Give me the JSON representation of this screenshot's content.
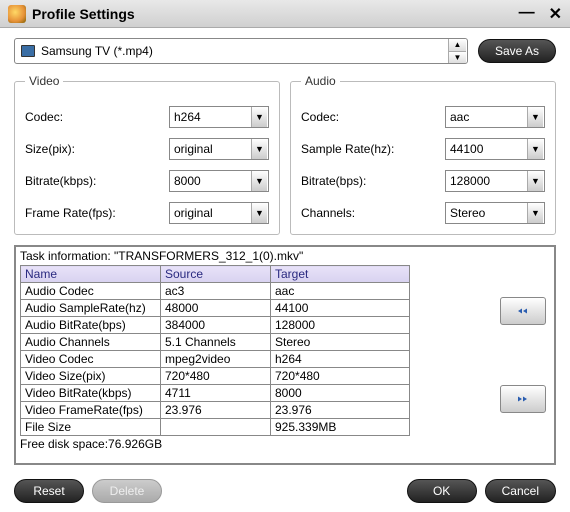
{
  "window": {
    "title": "Profile Settings"
  },
  "profile": {
    "name": "Samsung TV (*.mp4)",
    "save_as": "Save As"
  },
  "video": {
    "legend": "Video",
    "codec_label": "Codec:",
    "codec": "h264",
    "size_label": "Size(pix):",
    "size": "original",
    "bitrate_label": "Bitrate(kbps):",
    "bitrate": "8000",
    "fps_label": "Frame Rate(fps):",
    "fps": "original"
  },
  "audio": {
    "legend": "Audio",
    "codec_label": "Codec:",
    "codec": "aac",
    "sr_label": "Sample Rate(hz):",
    "sr": "44100",
    "bitrate_label": "Bitrate(bps):",
    "bitrate": "128000",
    "ch_label": "Channels:",
    "ch": "Stereo"
  },
  "task": {
    "header": "Task information: \"TRANSFORMERS_312_1(0).mkv\"",
    "cols": {
      "name": "Name",
      "source": "Source",
      "target": "Target"
    },
    "rows": [
      {
        "n": "Audio Codec",
        "s": "ac3",
        "t": "aac"
      },
      {
        "n": "Audio SampleRate(hz)",
        "s": "48000",
        "t": "44100"
      },
      {
        "n": "Audio BitRate(bps)",
        "s": "384000",
        "t": "128000"
      },
      {
        "n": "Audio Channels",
        "s": "5.1 Channels",
        "t": "Stereo"
      },
      {
        "n": "Video Codec",
        "s": "mpeg2video",
        "t": "h264"
      },
      {
        "n": "Video Size(pix)",
        "s": "720*480",
        "t": "720*480"
      },
      {
        "n": "Video BitRate(kbps)",
        "s": "4711",
        "t": "8000"
      },
      {
        "n": "Video FrameRate(fps)",
        "s": "23.976",
        "t": "23.976"
      },
      {
        "n": "File Size",
        "s": "",
        "t": "925.339MB"
      }
    ],
    "free": "Free disk space:76.926GB"
  },
  "buttons": {
    "reset": "Reset",
    "delete": "Delete",
    "ok": "OK",
    "cancel": "Cancel"
  }
}
